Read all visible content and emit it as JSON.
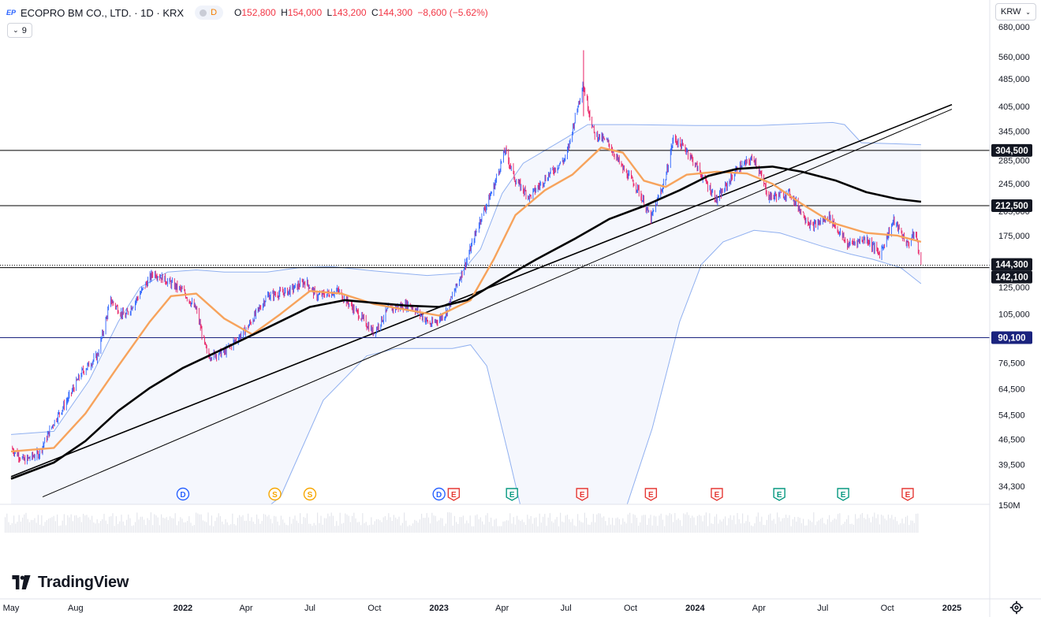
{
  "header": {
    "logo_glyph": "EP",
    "title": "ECOPRO BM CO., LTD. · 1D · KRX",
    "badge_letter": "D",
    "ohlc": {
      "o_label": "O",
      "o": "152,800",
      "h_label": "H",
      "h": "154,000",
      "l_label": "L",
      "l": "143,200",
      "c_label": "C",
      "c": "144,300",
      "change": "−8,600 (−5.62%)"
    },
    "collapse_label": "9"
  },
  "currency_selector": {
    "value": "KRW",
    "chevron": "⌄"
  },
  "branding": {
    "name": "TradingView"
  },
  "icons": {
    "settings": "gear-icon",
    "logo": "tradingview-logo-icon",
    "collapse": "chevron-down-icon"
  },
  "colors": {
    "up": "#2962ff",
    "down": "#e91e63",
    "ma_short": "#f7a35c",
    "ma_long": "#000000",
    "band": "#90b0f0",
    "band_fill": "rgba(180,190,240,0.13)",
    "change_negative": "#f23645"
  },
  "chart_data": {
    "type": "line",
    "instrument": "ECOPRO BM CO., LTD.",
    "interval": "1D",
    "exchange": "KRX",
    "y_scale": "log",
    "ylim": [
      30000,
      700000
    ],
    "x_ticks": [
      "May",
      "Aug",
      "2022",
      "Apr",
      "Jul",
      "Oct",
      "2023",
      "Apr",
      "Jul",
      "Oct",
      "2024",
      "Apr",
      "Jul",
      "Oct",
      "2025"
    ],
    "x_tick_dates": [
      "2021-05-01",
      "2021-08-01",
      "2022-01-01",
      "2022-04-01",
      "2022-07-01",
      "2022-10-01",
      "2023-01-01",
      "2023-04-01",
      "2023-07-01",
      "2023-10-01",
      "2024-01-01",
      "2024-04-01",
      "2024-07-01",
      "2024-10-01",
      "2025-01-01"
    ],
    "y_ticks": [
      "680,000",
      "560,000",
      "485,000",
      "405,000",
      "345,000",
      "285,000",
      "245,000",
      "205,000",
      "175,000",
      "125,000",
      "105,000",
      "76,500",
      "64,500",
      "54,500",
      "46,500",
      "39,500",
      "34,300"
    ],
    "y_tick_values": [
      680000,
      560000,
      485000,
      405000,
      345000,
      285000,
      245000,
      205000,
      175000,
      125000,
      105000,
      76500,
      64500,
      54500,
      46500,
      39500,
      34300
    ],
    "volume_axis_label": "150M",
    "last_price": {
      "label": "144,300",
      "value": 144300
    },
    "horizontal_levels": [
      {
        "label": "304,500",
        "value": 304500,
        "color": "#000000",
        "style": "solid"
      },
      {
        "label": "212,500",
        "value": 212500,
        "color": "#000000",
        "style": "solid"
      },
      {
        "label": "142,100",
        "value": 142100,
        "color": "#000000",
        "style": "solid"
      },
      {
        "label": "90,100",
        "value": 90100,
        "color": "#1a237e",
        "style": "solid"
      }
    ],
    "trend_lines": [
      {
        "from": {
          "date": "2021-05-01",
          "value": 36500
        },
        "to": {
          "date": "2025-01-01",
          "value": 410000
        }
      },
      {
        "from": {
          "date": "2021-06-15",
          "value": 32000
        },
        "to": {
          "date": "2025-01-01",
          "value": 398000
        }
      }
    ],
    "close_path": [
      {
        "d": "2021-05-01",
        "v": 44000
      },
      {
        "d": "2021-05-20",
        "v": 40500
      },
      {
        "d": "2021-06-10",
        "v": 42500
      },
      {
        "d": "2021-07-01",
        "v": 52000
      },
      {
        "d": "2021-07-20",
        "v": 60000
      },
      {
        "d": "2021-08-10",
        "v": 72000
      },
      {
        "d": "2021-09-01",
        "v": 80000
      },
      {
        "d": "2021-09-20",
        "v": 115000
      },
      {
        "d": "2021-10-10",
        "v": 103000
      },
      {
        "d": "2021-11-01",
        "v": 120000
      },
      {
        "d": "2021-11-20",
        "v": 138000
      },
      {
        "d": "2021-12-10",
        "v": 130000
      },
      {
        "d": "2022-01-01",
        "v": 122000
      },
      {
        "d": "2022-01-20",
        "v": 108000
      },
      {
        "d": "2022-02-05",
        "v": 80000
      },
      {
        "d": "2022-03-01",
        "v": 82000
      },
      {
        "d": "2022-04-01",
        "v": 95000
      },
      {
        "d": "2022-05-01",
        "v": 118000
      },
      {
        "d": "2022-06-01",
        "v": 122000
      },
      {
        "d": "2022-06-25",
        "v": 130000
      },
      {
        "d": "2022-07-10",
        "v": 118000
      },
      {
        "d": "2022-08-10",
        "v": 122000
      },
      {
        "d": "2022-09-10",
        "v": 104000
      },
      {
        "d": "2022-09-30",
        "v": 93000
      },
      {
        "d": "2022-10-20",
        "v": 108000
      },
      {
        "d": "2022-11-20",
        "v": 112000
      },
      {
        "d": "2022-12-20",
        "v": 98000
      },
      {
        "d": "2023-01-10",
        "v": 105000
      },
      {
        "d": "2023-02-10",
        "v": 150000
      },
      {
        "d": "2023-03-01",
        "v": 195000
      },
      {
        "d": "2023-03-20",
        "v": 240000
      },
      {
        "d": "2023-04-05",
        "v": 305000
      },
      {
        "d": "2023-04-20",
        "v": 250000
      },
      {
        "d": "2023-05-10",
        "v": 225000
      },
      {
        "d": "2023-06-10",
        "v": 265000
      },
      {
        "d": "2023-07-01",
        "v": 290000
      },
      {
        "d": "2023-07-25",
        "v": 470000
      },
      {
        "d": "2023-08-10",
        "v": 340000
      },
      {
        "d": "2023-08-30",
        "v": 320000
      },
      {
        "d": "2023-09-20",
        "v": 270000
      },
      {
        "d": "2023-10-10",
        "v": 240000
      },
      {
        "d": "2023-10-30",
        "v": 195000
      },
      {
        "d": "2023-11-20",
        "v": 255000
      },
      {
        "d": "2023-12-01",
        "v": 330000
      },
      {
        "d": "2023-12-20",
        "v": 305000
      },
      {
        "d": "2024-01-10",
        "v": 260000
      },
      {
        "d": "2024-02-01",
        "v": 220000
      },
      {
        "d": "2024-03-01",
        "v": 270000
      },
      {
        "d": "2024-03-25",
        "v": 290000
      },
      {
        "d": "2024-04-15",
        "v": 225000
      },
      {
        "d": "2024-05-15",
        "v": 230000
      },
      {
        "d": "2024-06-15",
        "v": 185000
      },
      {
        "d": "2024-07-10",
        "v": 198000
      },
      {
        "d": "2024-08-05",
        "v": 165000
      },
      {
        "d": "2024-09-01",
        "v": 172000
      },
      {
        "d": "2024-09-20",
        "v": 155000
      },
      {
        "d": "2024-10-10",
        "v": 193000
      },
      {
        "d": "2024-10-30",
        "v": 165000
      },
      {
        "d": "2024-11-10",
        "v": 180000
      },
      {
        "d": "2024-11-18",
        "v": 144300
      }
    ],
    "series": [
      {
        "values": [
          {
            "d": "2021-05-01",
            "v": 43000
          },
          {
            "d": "2021-07-01",
            "v": 44000
          },
          {
            "d": "2021-08-15",
            "v": 55000
          },
          {
            "d": "2021-10-01",
            "v": 75000
          },
          {
            "d": "2021-11-15",
            "v": 100000
          },
          {
            "d": "2021-12-15",
            "v": 118000
          },
          {
            "d": "2022-01-20",
            "v": 120000
          },
          {
            "d": "2022-03-01",
            "v": 102000
          },
          {
            "d": "2022-04-10",
            "v": 92000
          },
          {
            "d": "2022-05-20",
            "v": 105000
          },
          {
            "d": "2022-07-01",
            "v": 122000
          },
          {
            "d": "2022-08-15",
            "v": 120000
          },
          {
            "d": "2022-10-01",
            "v": 112000
          },
          {
            "d": "2022-11-15",
            "v": 108000
          },
          {
            "d": "2023-01-01",
            "v": 104000
          },
          {
            "d": "2023-02-15",
            "v": 115000
          },
          {
            "d": "2023-03-20",
            "v": 150000
          },
          {
            "d": "2023-04-20",
            "v": 200000
          },
          {
            "d": "2023-06-01",
            "v": 235000
          },
          {
            "d": "2023-07-10",
            "v": 260000
          },
          {
            "d": "2023-08-20",
            "v": 310000
          },
          {
            "d": "2023-09-20",
            "v": 300000
          },
          {
            "d": "2023-10-20",
            "v": 250000
          },
          {
            "d": "2023-11-20",
            "v": 240000
          },
          {
            "d": "2023-12-20",
            "v": 260000
          },
          {
            "d": "2024-02-01",
            "v": 265000
          },
          {
            "d": "2024-03-15",
            "v": 262000
          },
          {
            "d": "2024-04-20",
            "v": 245000
          },
          {
            "d": "2024-06-01",
            "v": 215000
          },
          {
            "d": "2024-07-15",
            "v": 190000
          },
          {
            "d": "2024-09-01",
            "v": 178000
          },
          {
            "d": "2024-10-15",
            "v": 175000
          },
          {
            "d": "2024-11-18",
            "v": 168000
          }
        ]
      },
      {
        "values": [
          {
            "d": "2021-05-01",
            "v": 36000
          },
          {
            "d": "2021-07-01",
            "v": 40000
          },
          {
            "d": "2021-08-15",
            "v": 46000
          },
          {
            "d": "2021-10-01",
            "v": 56000
          },
          {
            "d": "2021-11-15",
            "v": 65000
          },
          {
            "d": "2022-01-01",
            "v": 74000
          },
          {
            "d": "2022-03-01",
            "v": 84000
          },
          {
            "d": "2022-05-01",
            "v": 96000
          },
          {
            "d": "2022-07-01",
            "v": 110000
          },
          {
            "d": "2022-08-20",
            "v": 115000
          },
          {
            "d": "2022-10-01",
            "v": 113000
          },
          {
            "d": "2022-11-15",
            "v": 111000
          },
          {
            "d": "2023-01-01",
            "v": 110000
          },
          {
            "d": "2023-02-10",
            "v": 115000
          },
          {
            "d": "2023-04-01",
            "v": 132000
          },
          {
            "d": "2023-05-20",
            "v": 150000
          },
          {
            "d": "2023-07-15",
            "v": 172000
          },
          {
            "d": "2023-09-01",
            "v": 195000
          },
          {
            "d": "2023-10-20",
            "v": 212000
          },
          {
            "d": "2023-12-10",
            "v": 235000
          },
          {
            "d": "2024-01-20",
            "v": 258000
          },
          {
            "d": "2024-03-01",
            "v": 270000
          },
          {
            "d": "2024-04-20",
            "v": 274000
          },
          {
            "d": "2024-06-01",
            "v": 265000
          },
          {
            "d": "2024-07-20",
            "v": 250000
          },
          {
            "d": "2024-09-01",
            "v": 232000
          },
          {
            "d": "2024-10-15",
            "v": 222000
          },
          {
            "d": "2024-11-18",
            "v": 218000
          }
        ]
      }
    ],
    "bands": {
      "upper": [
        {
          "d": "2021-05-01",
          "v": 48000
        },
        {
          "d": "2021-07-01",
          "v": 49000
        },
        {
          "d": "2021-08-20",
          "v": 68000
        },
        {
          "d": "2021-10-01",
          "v": 100000
        },
        {
          "d": "2021-11-01",
          "v": 125000
        },
        {
          "d": "2021-12-10",
          "v": 138000
        },
        {
          "d": "2022-01-20",
          "v": 140000
        },
        {
          "d": "2022-03-01",
          "v": 138000
        },
        {
          "d": "2022-05-01",
          "v": 138000
        },
        {
          "d": "2022-06-15",
          "v": 142000
        },
        {
          "d": "2022-08-01",
          "v": 143000
        },
        {
          "d": "2022-10-01",
          "v": 139000
        },
        {
          "d": "2022-12-15",
          "v": 135000
        },
        {
          "d": "2023-02-01",
          "v": 137000
        },
        {
          "d": "2023-03-01",
          "v": 160000
        },
        {
          "d": "2023-04-01",
          "v": 230000
        },
        {
          "d": "2023-05-01",
          "v": 280000
        },
        {
          "d": "2023-07-01",
          "v": 330000
        },
        {
          "d": "2023-08-01",
          "v": 360000
        },
        {
          "d": "2023-10-01",
          "v": 360000
        },
        {
          "d": "2024-01-01",
          "v": 358000
        },
        {
          "d": "2024-04-01",
          "v": 358000
        },
        {
          "d": "2024-07-15",
          "v": 365000
        },
        {
          "d": "2024-08-01",
          "v": 360000
        },
        {
          "d": "2024-08-25",
          "v": 320000
        },
        {
          "d": "2024-11-18",
          "v": 316000
        }
      ],
      "lower": [
        {
          "d": "2021-05-01",
          "v": 24000
        },
        {
          "d": "2022-03-01",
          "v": 24000
        },
        {
          "d": "2022-05-20",
          "v": 32000
        },
        {
          "d": "2022-07-20",
          "v": 60000
        },
        {
          "d": "2022-09-20",
          "v": 80000
        },
        {
          "d": "2022-11-01",
          "v": 84000
        },
        {
          "d": "2023-01-20",
          "v": 84000
        },
        {
          "d": "2023-02-15",
          "v": 86000
        },
        {
          "d": "2023-03-10",
          "v": 75000
        },
        {
          "d": "2023-04-10",
          "v": 42000
        },
        {
          "d": "2023-05-01",
          "v": 28000
        },
        {
          "d": "2023-09-20",
          "v": 28000
        },
        {
          "d": "2023-11-01",
          "v": 50000
        },
        {
          "d": "2023-12-10",
          "v": 100000
        },
        {
          "d": "2024-01-10",
          "v": 145000
        },
        {
          "d": "2024-02-10",
          "v": 168000
        },
        {
          "d": "2024-03-25",
          "v": 181000
        },
        {
          "d": "2024-05-01",
          "v": 178000
        },
        {
          "d": "2024-07-01",
          "v": 163000
        },
        {
          "d": "2024-08-10",
          "v": 155000
        },
        {
          "d": "2024-09-10",
          "v": 150000
        },
        {
          "d": "2024-10-20",
          "v": 142000
        },
        {
          "d": "2024-11-18",
          "v": 128000
        }
      ]
    },
    "spike_high": {
      "d": "2023-07-26",
      "v": 584000
    },
    "event_markers": [
      {
        "letter": "D",
        "date": "2022-01-01",
        "color": "#2962ff"
      },
      {
        "letter": "S",
        "date": "2022-05-12",
        "color": "#f7a600"
      },
      {
        "letter": "S",
        "date": "2022-07-01",
        "color": "#f7a600"
      },
      {
        "letter": "D",
        "date": "2023-01-01",
        "color": "#2962ff"
      },
      {
        "letter": "E",
        "date": "2023-01-22",
        "color": "#e53935"
      },
      {
        "letter": "E",
        "date": "2023-04-15",
        "color": "#089981"
      },
      {
        "letter": "E",
        "date": "2023-07-24",
        "color": "#e53935"
      },
      {
        "letter": "E",
        "date": "2023-10-30",
        "color": "#e53935"
      },
      {
        "letter": "E",
        "date": "2024-02-01",
        "color": "#e53935"
      },
      {
        "letter": "E",
        "date": "2024-04-30",
        "color": "#089981"
      },
      {
        "letter": "E",
        "date": "2024-07-30",
        "color": "#089981"
      },
      {
        "letter": "E",
        "date": "2024-10-30",
        "color": "#e53935"
      }
    ],
    "grid": false,
    "legend_position": "top-left"
  }
}
